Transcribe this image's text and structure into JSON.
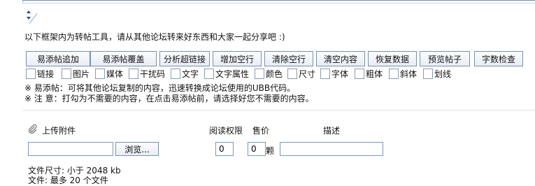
{
  "intro": "以下框架内为转帖工具，请从其他论坛转来好东西和大家一起分享吧 :)",
  "buttons": [
    "易添帖追加",
    "易添帖覆盖",
    "分析超链接",
    "增加空行",
    "清除空行",
    "清空内容",
    "恢复数据",
    "预览帖子",
    "字数检查"
  ],
  "options": [
    "链接",
    "图片",
    "媒体",
    "干扰码",
    "文字",
    "文字属性",
    "颜色",
    "尺寸",
    "字体",
    "粗体",
    "斜体",
    "划线"
  ],
  "notes": {
    "note1": "※ 易添帖：可将其他论坛复制的内容，迅速转换成论坛使用的UBB代码。",
    "note2": "※ 注 意：打勾为不需要的内容，在点击易添帖前，请选择好您不需要的内容。"
  },
  "attachment": {
    "upload_label": "上传附件",
    "permission_label": "阅读权限",
    "price_label": "售价",
    "description_label": "描述",
    "browse_label": "浏览...",
    "permission_value": "0",
    "price_value": "0",
    "price_unit": "颗",
    "size_note": "文件尺寸: 小于 2048 kb",
    "cut_note": "文件: 最多 20 个文件"
  },
  "icons": {
    "paperclip": "paperclip-icon",
    "resize": "resize-handle-icon"
  }
}
